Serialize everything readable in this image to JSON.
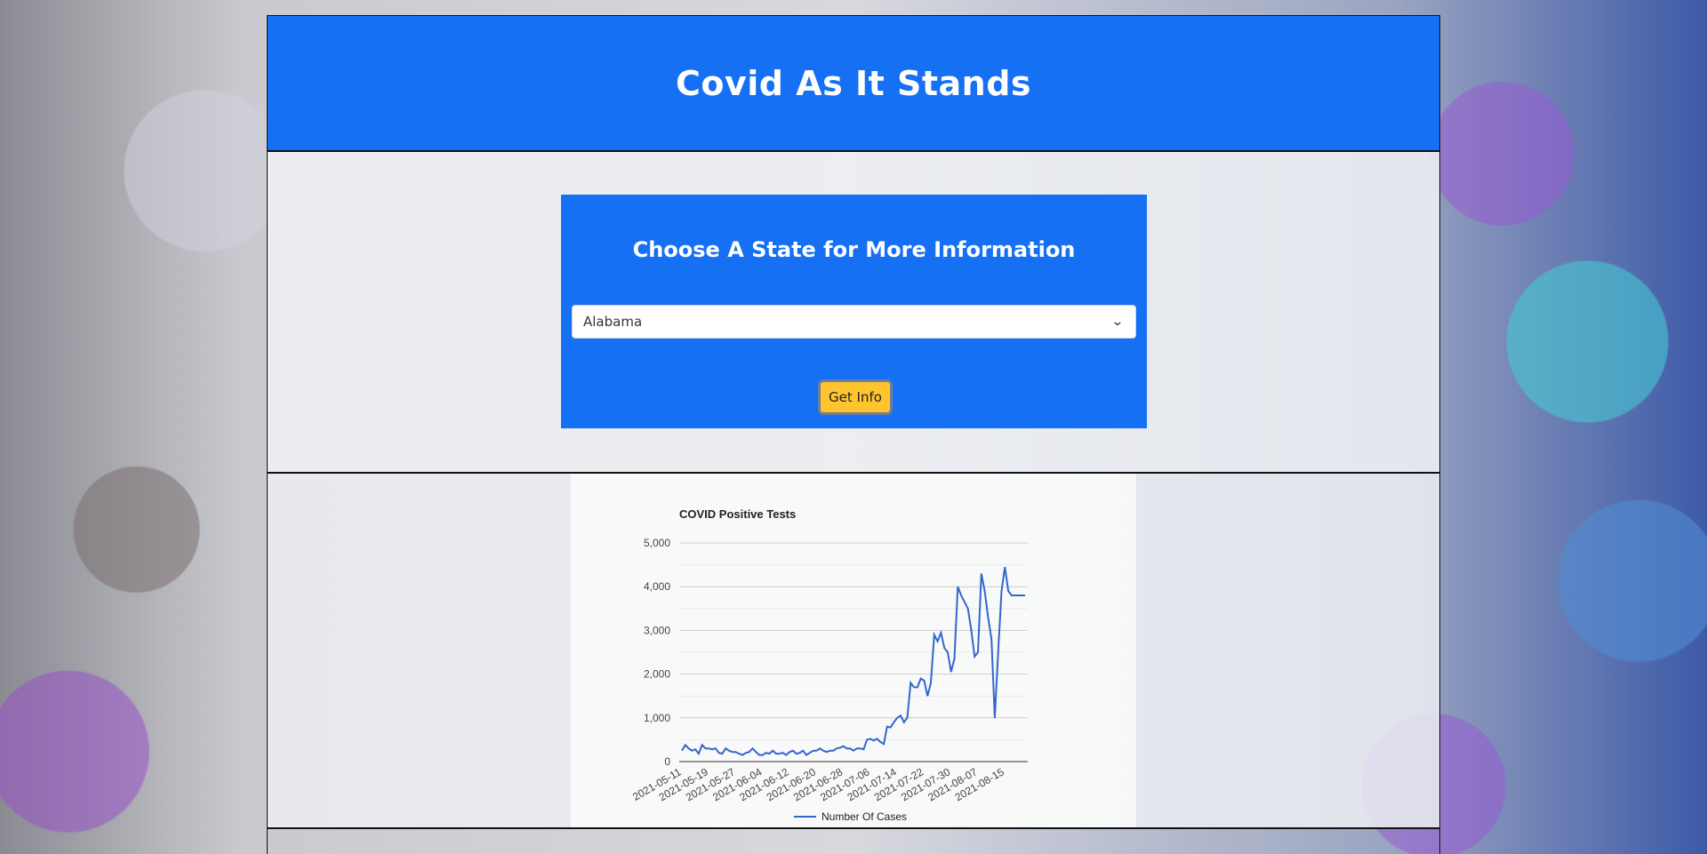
{
  "header": {
    "title": "Covid As It Stands"
  },
  "selector": {
    "heading": "Choose A State for More Information",
    "selected_state": "Alabama",
    "button_label": "Get Info"
  },
  "colors": {
    "primary": "#1570f4",
    "button": "#ffc42e",
    "line": "#3366cc"
  },
  "chart_data": {
    "type": "line",
    "title": "COVID Positive Tests",
    "xlabel": "",
    "ylabel": "",
    "ylim": [
      0,
      5000
    ],
    "yticks": [
      0,
      1000,
      2000,
      3000,
      4000,
      5000
    ],
    "ytick_labels": [
      "0",
      "1,000",
      "2,000",
      "3,000",
      "4,000",
      "5,000"
    ],
    "xtick_labels": [
      "2021-05-11",
      "2021-05-19",
      "2021-05-27",
      "2021-06-04",
      "2021-06-12",
      "2021-06-20",
      "2021-06-28",
      "2021-07-06",
      "2021-07-14",
      "2021-07-22",
      "2021-07-30",
      "2021-08-07",
      "2021-08-15"
    ],
    "grid": true,
    "legend": "bottom",
    "series": [
      {
        "name": "Number Of Cases",
        "x": [
          "2021-05-11",
          "2021-05-12",
          "2021-05-13",
          "2021-05-14",
          "2021-05-15",
          "2021-05-16",
          "2021-05-17",
          "2021-05-18",
          "2021-05-19",
          "2021-05-20",
          "2021-05-21",
          "2021-05-22",
          "2021-05-23",
          "2021-05-24",
          "2021-05-25",
          "2021-05-26",
          "2021-05-27",
          "2021-05-28",
          "2021-05-29",
          "2021-05-30",
          "2021-05-31",
          "2021-06-01",
          "2021-06-02",
          "2021-06-03",
          "2021-06-04",
          "2021-06-05",
          "2021-06-06",
          "2021-06-07",
          "2021-06-08",
          "2021-06-09",
          "2021-06-10",
          "2021-06-11",
          "2021-06-12",
          "2021-06-13",
          "2021-06-14",
          "2021-06-15",
          "2021-06-16",
          "2021-06-17",
          "2021-06-18",
          "2021-06-19",
          "2021-06-20",
          "2021-06-21",
          "2021-06-22",
          "2021-06-23",
          "2021-06-24",
          "2021-06-25",
          "2021-06-26",
          "2021-06-27",
          "2021-06-28",
          "2021-06-29",
          "2021-06-30",
          "2021-07-01",
          "2021-07-02",
          "2021-07-03",
          "2021-07-04",
          "2021-07-05",
          "2021-07-06",
          "2021-07-07",
          "2021-07-08",
          "2021-07-09",
          "2021-07-10",
          "2021-07-11",
          "2021-07-12",
          "2021-07-13",
          "2021-07-14",
          "2021-07-15",
          "2021-07-16",
          "2021-07-17",
          "2021-07-18",
          "2021-07-19",
          "2021-07-20",
          "2021-07-21",
          "2021-07-22",
          "2021-07-23",
          "2021-07-24",
          "2021-07-25",
          "2021-07-26",
          "2021-07-27",
          "2021-07-28",
          "2021-07-29",
          "2021-07-30",
          "2021-07-31",
          "2021-08-01",
          "2021-08-02",
          "2021-08-03",
          "2021-08-04",
          "2021-08-05",
          "2021-08-06",
          "2021-08-07",
          "2021-08-08",
          "2021-08-09",
          "2021-08-10",
          "2021-08-11",
          "2021-08-12",
          "2021-08-13",
          "2021-08-14",
          "2021-08-15",
          "2021-08-16",
          "2021-08-17",
          "2021-08-18",
          "2021-08-19",
          "2021-08-20",
          "2021-08-21"
        ],
        "values": [
          250,
          380,
          300,
          250,
          280,
          180,
          380,
          300,
          300,
          280,
          300,
          200,
          180,
          300,
          250,
          220,
          220,
          180,
          150,
          200,
          220,
          300,
          220,
          150,
          150,
          200,
          180,
          250,
          180,
          180,
          200,
          150,
          220,
          250,
          180,
          200,
          250,
          150,
          200,
          250,
          250,
          300,
          250,
          220,
          250,
          250,
          300,
          320,
          350,
          300,
          300,
          250,
          300,
          300,
          280,
          500,
          520,
          480,
          520,
          450,
          400,
          800,
          780,
          900,
          1000,
          1050,
          900,
          1000,
          1800,
          1700,
          1700,
          1900,
          1850,
          1500,
          1800,
          2900,
          2750,
          2950,
          2600,
          2500,
          2050,
          2350,
          4000,
          3800,
          3650,
          3500,
          3000,
          2400,
          2500,
          4300,
          3900,
          3300,
          2800,
          1000,
          2500,
          3900,
          4450,
          3900,
          3800,
          3800,
          3800,
          3800,
          3800
        ]
      }
    ]
  }
}
